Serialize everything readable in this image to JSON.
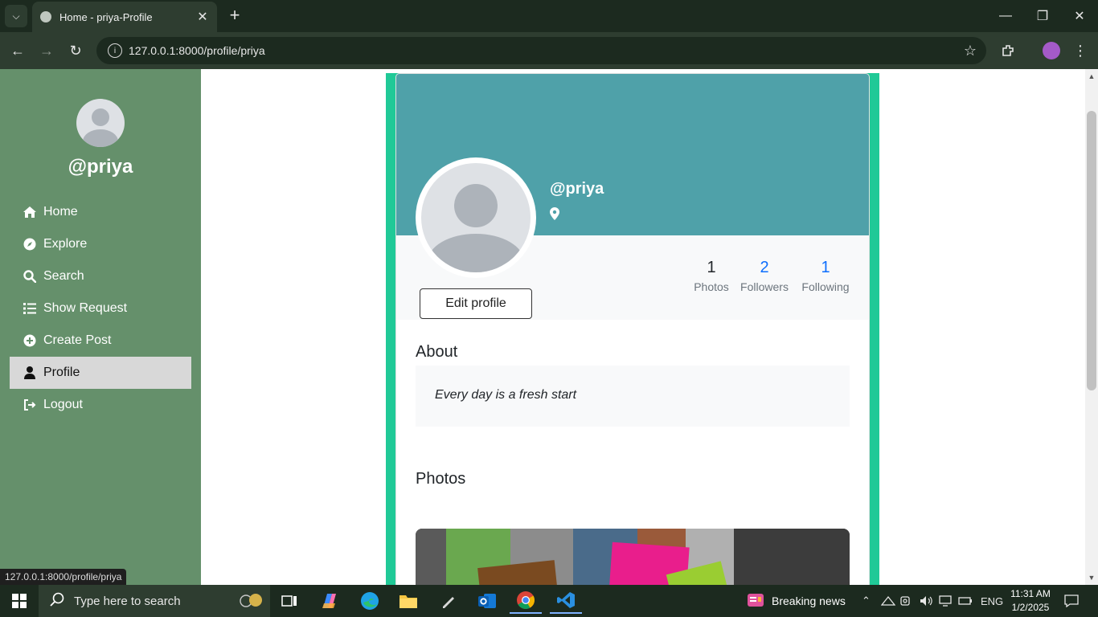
{
  "browser": {
    "tab_title": "Home - priya-Profile",
    "url": "127.0.0.1:8000/profile/priya",
    "status_url": "127.0.0.1:8000/profile/priya"
  },
  "sidebar": {
    "username": "@priya",
    "items": [
      {
        "label": "Home",
        "icon": "home-icon"
      },
      {
        "label": "Explore",
        "icon": "compass-icon"
      },
      {
        "label": "Search",
        "icon": "search-icon"
      },
      {
        "label": "Show Request",
        "icon": "list-icon"
      },
      {
        "label": "Create Post",
        "icon": "plus-circle-icon"
      },
      {
        "label": "Profile",
        "icon": "user-icon",
        "active": true
      },
      {
        "label": "Logout",
        "icon": "logout-icon"
      }
    ]
  },
  "profile": {
    "username": "@priya",
    "edit_label": "Edit profile",
    "stats": {
      "photos": {
        "value": "1",
        "label": "Photos"
      },
      "followers": {
        "value": "2",
        "label": "Followers"
      },
      "following": {
        "value": "1",
        "label": "Following"
      }
    },
    "about_heading": "About",
    "about_text": "Every day is a fresh start",
    "photos_heading": "Photos"
  },
  "colors": {
    "sidebar": "#65906b",
    "cover": "#4fa1a9",
    "frame": "#20c997",
    "link": "#0d6efd"
  },
  "taskbar": {
    "search_placeholder": "Type here to search",
    "news": "Breaking news",
    "lang": "ENG",
    "time": "11:31 AM",
    "date": "1/2/2025"
  }
}
